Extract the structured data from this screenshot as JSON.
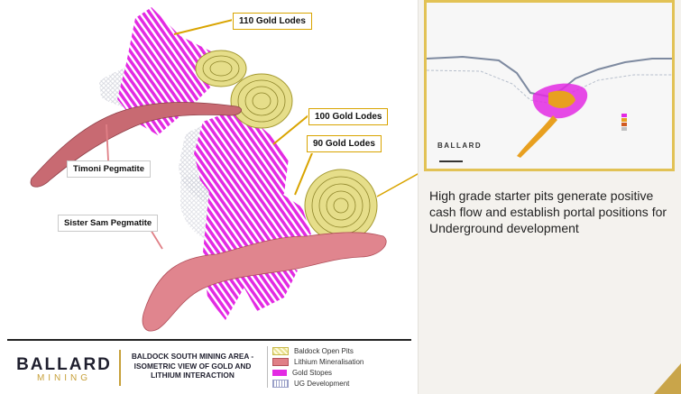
{
  "callouts": {
    "lodes_110": "110 Gold Lodes",
    "lodes_100": "100 Gold Lodes",
    "lodes_90": "90 Gold Lodes"
  },
  "pegmatites": {
    "timoni": "Timoni Pegmatite",
    "sister_sam": "Sister Sam Pegmatite"
  },
  "brand": {
    "top": "BALLARD",
    "bottom": "MINING"
  },
  "caption": "BALDOCK SOUTH MINING AREA - ISOMETRIC VIEW OF GOLD AND LITHIUM INTERACTION",
  "legend": [
    {
      "label": "Baldock Open Pits",
      "swatch": "pits"
    },
    {
      "label": "Lithium Mineralisation",
      "swatch": "li"
    },
    {
      "label": "Gold Stopes",
      "swatch": "gold"
    },
    {
      "label": "UG Development",
      "swatch": "ug"
    }
  ],
  "inset": {
    "brand": "BALLARD"
  },
  "description": "High grade starter pits generate positive cash flow and establish portal positions for Underground development",
  "colors": {
    "gold_stopes": "#e32ae3",
    "lithium": "#d9737d",
    "pits": "#e8e090",
    "accent": "#d9a400"
  }
}
